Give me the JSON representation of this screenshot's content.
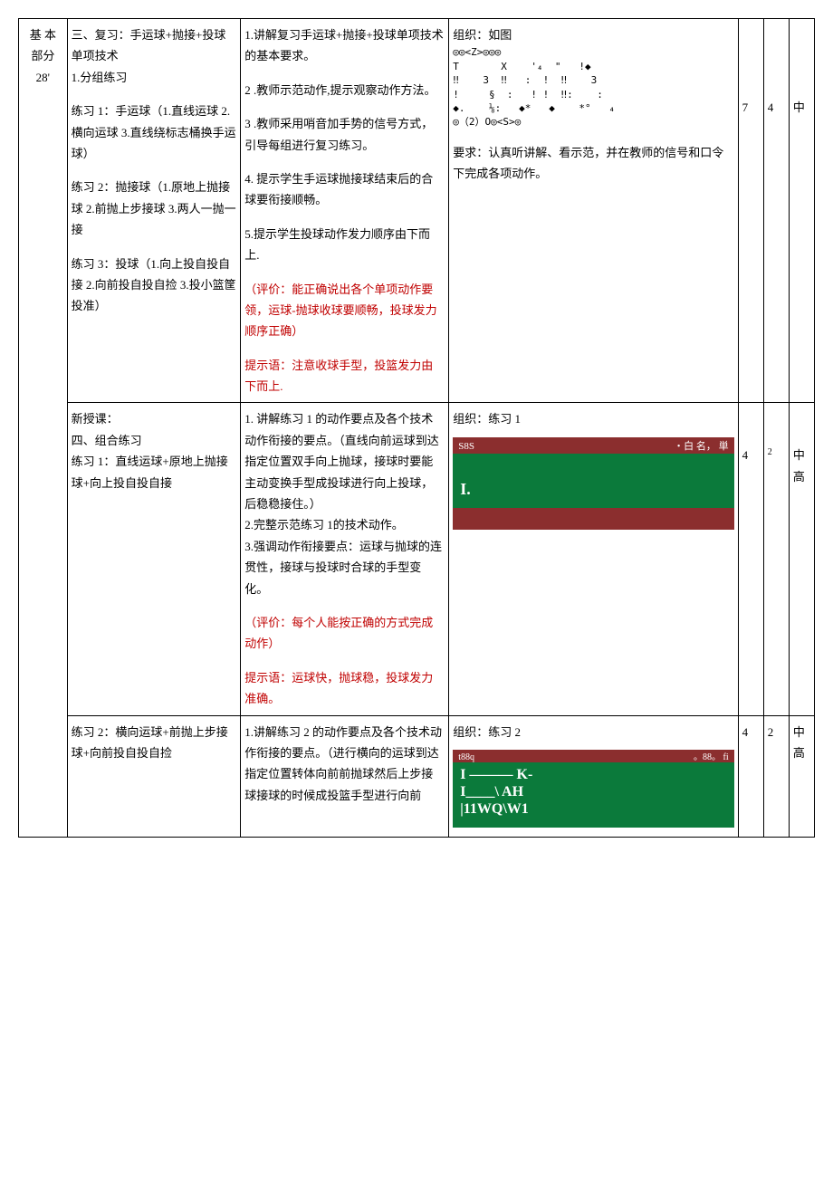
{
  "section": {
    "label1": "基 本",
    "label2": "部分",
    "minutes": "28'"
  },
  "row1": {
    "content_title": "三、复习：手运球+抛接+投球单项技术",
    "content_sub": "1.分组练习",
    "ex1": "练习 1：手运球（1.直线运球 2.横向运球 3.直线绕标志桶换手运球）",
    "ex2": "练习 2：抛接球（1.原地上抛接球 2.前抛上步接球 3.两人一抛一接",
    "ex3": "练习 3：投球（1.向上投自投自接 2.向前投自投自捡 3.投小篮筐投准）",
    "t1": "1.讲解复习手运球+抛接+投球单项技术的基本要求。",
    "t2": "2 .教师示范动作,提示观察动作方法。",
    "t3": "3 .教师采用哨音加手势的信号方式，引导每组进行复习练习。",
    "t4": "4. 提示学生手运球抛接球结束后的合球要衔接顺畅。",
    "t5": "5.提示学生投球动作发力顺序由下而上.",
    "eval": "（评价：能正确说出各个单项动作要领，运球-抛球收球要顺畅，投球发力顺序正确）",
    "hint": "提示语：注意收球手型，投篮发力由下而上.",
    "org_title": "组织：如图",
    "diagram": "◎◎<Z>◎◎◎\nT       X    '₄  \"   !◆\n‼    3  ‼   :  !  ‼    3\n!     §  :   ! !  ‼:    :\n◆.    ⅛:   ◆*   ◆    *°   ₄\n◎（2）O◎<S>◎",
    "org_req": "要求：认真听讲解、看示范，并在教师的信号和口令下完成各项动作。",
    "n1": "7",
    "n2": "4",
    "level": "中"
  },
  "row2": {
    "content_new": "新授课：",
    "content_title": "四、组合练习",
    "content_ex": "练习 1：直线运球+原地上抛接球+向上投自投自接",
    "t1": "1. 讲解练习 1 的动作要点及各个技术动作衔接的要点。（直线向前运球到达指定位置双手向上抛球，接球时要能主动变换手型成投球进行向上投球，后稳稳接住。）",
    "t2": "2.完整示范练习 1的技术动作。",
    "t3": "3.强调动作衔接要点：运球与抛球的连贯性，接球与投球时合球的手型变化。",
    "eval": "（评价：每个人能按正确的方式完成动作）",
    "hint": "提示语：运球快，抛球稳，投球发力准确。",
    "org_title": "组织：练习 1",
    "img_top_l": "S8S",
    "img_top_r": "・白 名，   単",
    "img_mid": "I.",
    "n1": "4",
    "n2": "2",
    "level1": "中",
    "level2": "高"
  },
  "row3": {
    "content_ex": "练习 2：横向运球+前抛上步接球+向前投自投自捡",
    "t1": "1.讲解练习 2 的动作要点及各个技术动作衔接的要点。（进行横向的运球到达指定位置转体向前前抛球然后上步接球接球的时候成投篮手型进行向前",
    "org_title": "组织：练习 2",
    "img2_top_l": "t88q",
    "img2_top_r": "。88。 fi",
    "img2_line1": "I   ———   K-",
    "img2_line2": "I____\\ AH",
    "img2_line3": "|11WQ\\W1",
    "n1": "4",
    "n2": "2",
    "level1": "中",
    "level2": "高"
  }
}
